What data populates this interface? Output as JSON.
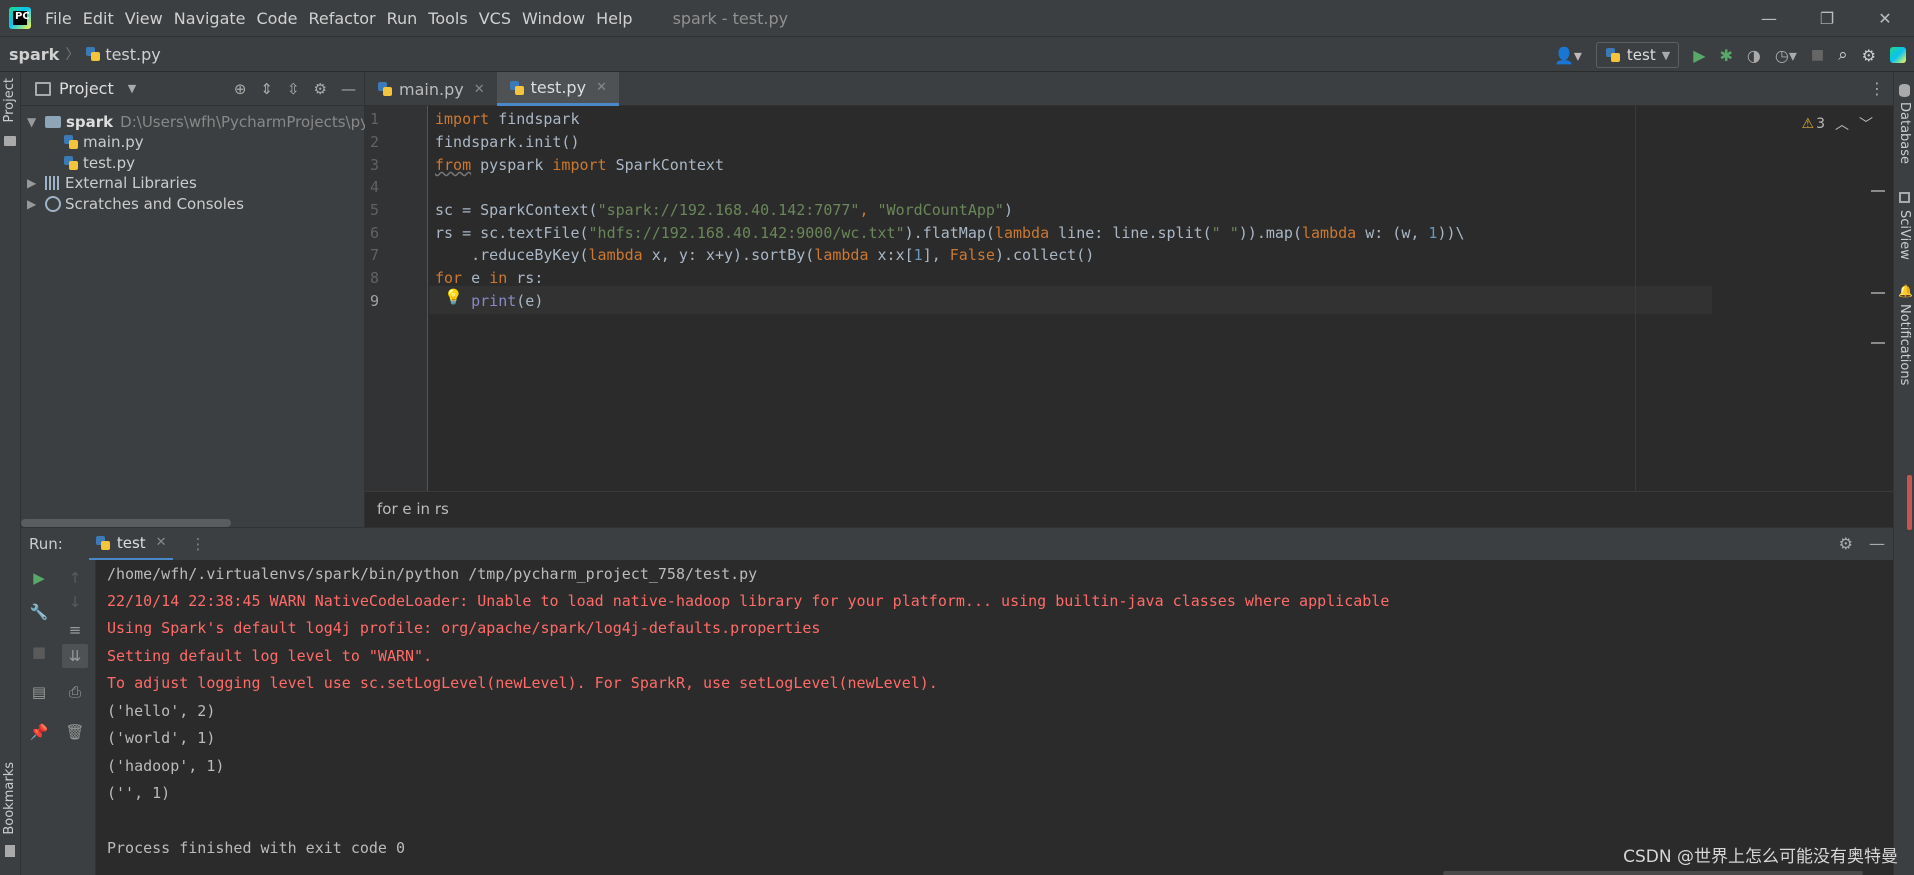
{
  "app": {
    "menu": [
      "File",
      "Edit",
      "View",
      "Navigate",
      "Code",
      "Refactor",
      "Run",
      "Tools",
      "VCS",
      "Window",
      "Help"
    ],
    "window_title": "spark - test.py",
    "controls": [
      "—",
      "❐",
      "✕"
    ]
  },
  "navbar": {
    "project": "spark",
    "file": "test.py",
    "run_config": "test"
  },
  "left_strip": {
    "project_tab": "Project",
    "bookmarks_tab": "Bookmarks"
  },
  "right_strip": {
    "database": "Database",
    "sciview": "SciView",
    "notifications": "Notifications"
  },
  "project_panel": {
    "title": "Project",
    "root_name": "spark",
    "root_path": "D:\\Users\\wfh\\PycharmProjects\\py",
    "files": [
      "main.py",
      "test.py"
    ],
    "external_libraries": "External Libraries",
    "scratches": "Scratches and Consoles"
  },
  "editor": {
    "tabs": [
      {
        "label": "main.py",
        "active": false
      },
      {
        "label": "test.py",
        "active": true
      }
    ],
    "warning_count": "3",
    "line_numbers": [
      "1",
      "2",
      "3",
      "4",
      "5",
      "6",
      "7",
      "8",
      "9"
    ],
    "breadcrumb": "for e in rs"
  },
  "code": {
    "l1_kw": "import",
    "l1_rest": " findspark",
    "l2": "findspark.init()",
    "l3_kw1": "from",
    "l3_mid": " pyspark ",
    "l3_kw2": "import",
    "l3_rest": " SparkContext",
    "l5_a": "sc = SparkContext(",
    "l5_s1": "\"spark://192.168.40.142:7077\"",
    "l5_b": ", ",
    "l5_s2": "\"WordCountApp\"",
    "l5_c": ")",
    "l6_a": "rs = sc.textFile(",
    "l6_s1": "\"hdfs://192.168.40.142:9000/wc.txt\"",
    "l6_b": ").flatMap(",
    "l6_kw1": "lambda",
    "l6_c": " line: line.split(",
    "l6_s2": "\" \"",
    "l6_d": ")).map(",
    "l6_kw2": "lambda",
    "l6_e": " w: (w, ",
    "l6_n1": "1",
    "l6_f": "))\\",
    "l7_a": "    .reduceByKey(",
    "l7_kw1": "lambda",
    "l7_b": " x, y: x+y).sortBy(",
    "l7_kw2": "lambda",
    "l7_c": " x:x[",
    "l7_n1": "1",
    "l7_d": "], ",
    "l7_kw3": "False",
    "l7_e": ").collect()",
    "l8_kw1": "for",
    "l8_a": " e ",
    "l8_kw2": "in",
    "l8_b": " rs:",
    "l9_indent": "    ",
    "l9_fn": "print",
    "l9_rest": "(e)"
  },
  "run": {
    "label": "Run:",
    "tab": "test",
    "console": [
      {
        "text": "/home/wfh/.virtualenvs/spark/bin/python /tmp/pycharm_project_758/test.py",
        "kind": "normal"
      },
      {
        "text": "22/10/14 22:38:45 WARN NativeCodeLoader: Unable to load native-hadoop library for your platform... using builtin-java classes where applicable",
        "kind": "err"
      },
      {
        "text": "Using Spark's default log4j profile: org/apache/spark/log4j-defaults.properties",
        "kind": "err"
      },
      {
        "text": "Setting default log level to \"WARN\".",
        "kind": "err"
      },
      {
        "text": "To adjust logging level use sc.setLogLevel(newLevel). For SparkR, use setLogLevel(newLevel).",
        "kind": "err"
      },
      {
        "text": "('hello', 2)",
        "kind": "normal"
      },
      {
        "text": "('world', 1)",
        "kind": "normal"
      },
      {
        "text": "('hadoop', 1)",
        "kind": "normal"
      },
      {
        "text": "('', 1)",
        "kind": "normal"
      },
      {
        "text": "",
        "kind": "normal"
      },
      {
        "text": "Process finished with exit code 0",
        "kind": "normal"
      }
    ]
  },
  "watermark": "CSDN @世界上怎么可能没有奥特曼"
}
